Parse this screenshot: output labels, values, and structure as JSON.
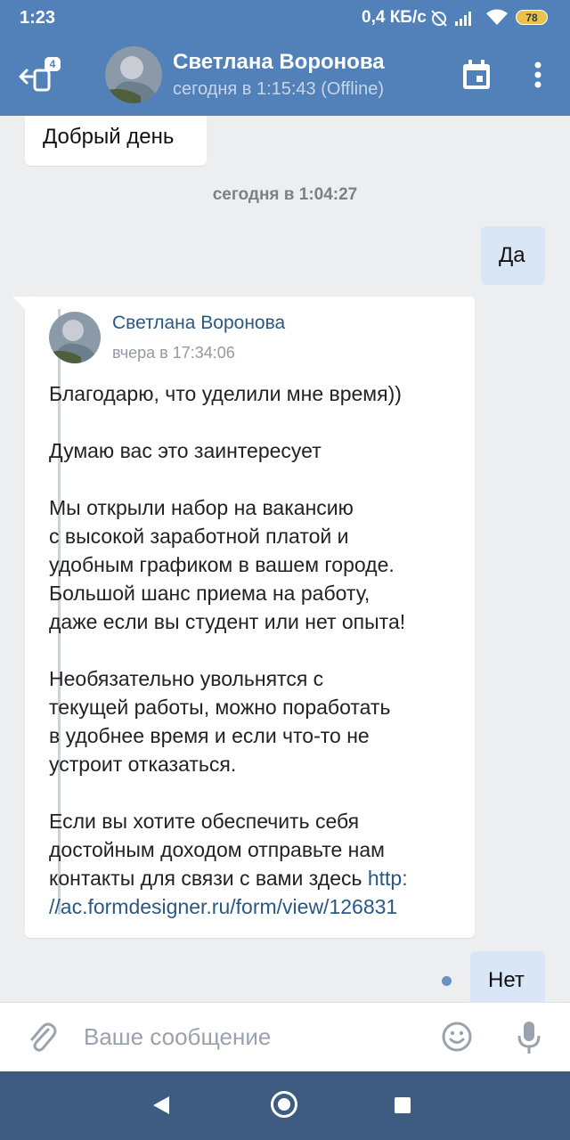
{
  "status_bar": {
    "time": "1:23",
    "network_speed": "0,4 КБ/с",
    "battery": "78"
  },
  "header": {
    "back_badge": "4",
    "contact_name": "Светлана Воронова",
    "contact_status": "сегодня в 1:15:43 (Offline)"
  },
  "messages": {
    "incoming_1": "Добрый день",
    "date_separator": "сегодня в 1:04:27",
    "outgoing_1": "Да",
    "forwarded": {
      "author": "Светлана Воронова",
      "time": "вчера в 17:34:06",
      "p1": "Благодарю, что уделили мне время))",
      "p2": "Думаю вас это заинтересует",
      "p3_line1": "Мы открыли набор на вакансию",
      "p3_line2": "с высокой заработной платой и",
      "p3_line3": "удобным графиком в вашем городе.",
      "p3_line4": "Большой шанс приема на работу,",
      "p3_line5": "даже если вы студент или нет опыта!",
      "p4_line1": "Необязательно увольнятся с",
      "p4_line2": "текущей работы, можно поработать",
      "p4_line3": "в удобнее время и если что-то не",
      "p4_line4": "устроит отказаться.",
      "p5_line1": "Если вы хотите обеспечить себя",
      "p5_line2": "достойным доходом отправьте нам",
      "p5_line3": "контакты для связи с вами здесь ",
      "link_part1": "http:",
      "link_part2": "//ac.formdesigner.ru/form/view/126831"
    },
    "outgoing_2": "Нет"
  },
  "composer": {
    "placeholder": "Ваше сообщение"
  },
  "colors": {
    "header_bg": "#5181b8",
    "nav_bg": "#3e5b82",
    "chat_bg": "#edeef0",
    "outgoing_bubble": "#d9e6f5",
    "link": "#2a5885"
  }
}
